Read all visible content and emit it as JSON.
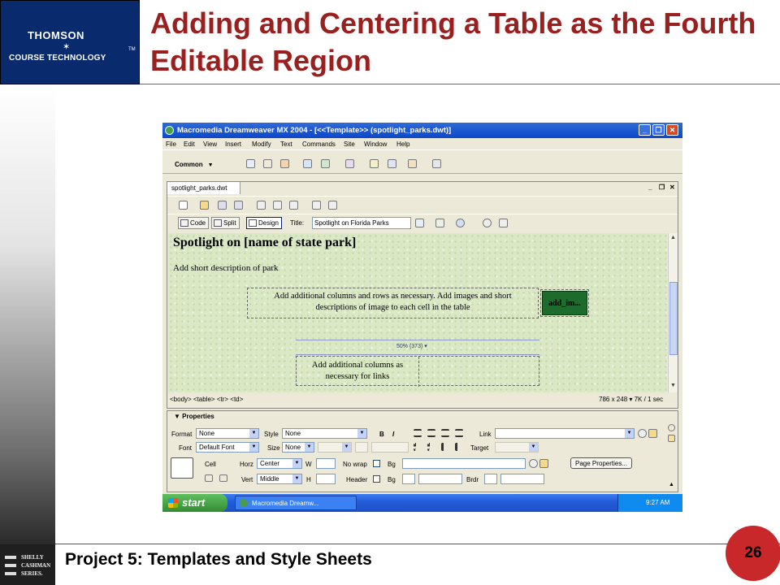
{
  "logo": {
    "line1": "THOMSON",
    "star": "✶",
    "line2": "COURSE TECHNOLOGY",
    "tm": "TM"
  },
  "slide_title": "Adding and Centering a Table as the Fourth Editable Region",
  "footer": {
    "text": "Project 5: Templates and Style Sheets",
    "page": "26",
    "series_logo": [
      "SHELLY",
      "CASHMAN",
      "SERIES."
    ]
  },
  "app": {
    "title": "Macromedia Dreamweaver MX 2004 - [<<Template>> (spotlight_parks.dwt)]",
    "menus": [
      "File",
      "Edit",
      "View",
      "Insert",
      "Modify",
      "Text",
      "Commands",
      "Site",
      "Window",
      "Help"
    ],
    "insert_category": "Common",
    "doc_tab": "spotlight_parks.dwt",
    "view_buttons": [
      "Code",
      "Split",
      "Design"
    ],
    "title_label": "Title:",
    "page_title_value": "Spotlight on Florida Parks",
    "design": {
      "heading": "Spotlight on [name of state park]",
      "short_description": "Add short description of park",
      "table_text_line1": "Add additional columns and rows as necessary. Add images and short",
      "table_text_line2": "descriptions of image to each cell in the table",
      "editable_region": "add_im...",
      "width_label": "50% (373) ▾",
      "link_text_line1": "Add additional columns as",
      "link_text_line2": "necessary for links"
    },
    "status": {
      "tags": "<body> <table> <tr> <td>",
      "size": "786 x 248 ▾ 7K / 1 sec"
    },
    "properties": {
      "header": "▼ Properties",
      "format_label": "Format",
      "format_value": "None",
      "style_label": "Style",
      "style_value": "None",
      "bold": "B",
      "italic": "I",
      "link_label": "Link",
      "font_label": "Font",
      "font_value": "Default Font",
      "size_label": "Size",
      "size_value": "None",
      "target_label": "Target",
      "cell_label": "Cell",
      "horz_label": "Horz",
      "horz_value": "Center",
      "w_label": "W",
      "nowrap_label": "No wrap",
      "bg_label": "Bg",
      "page_props_button": "Page Properties...",
      "vert_label": "Vert",
      "vert_value": "Middle",
      "h_label": "H",
      "header_label": "Header",
      "bg2_label": "Bg",
      "brdr_label": "Brdr"
    },
    "taskbar": {
      "start": "start",
      "task": "Macromedia Dreamw...",
      "clock": "9:27 AM"
    }
  },
  "colors": {
    "title": "#9a1f1f",
    "logo_bg": "#0a2a6e",
    "design_bg": "#dbe8c6",
    "editable_region": "#1e6b2e",
    "page_circle": "#c8282a"
  }
}
